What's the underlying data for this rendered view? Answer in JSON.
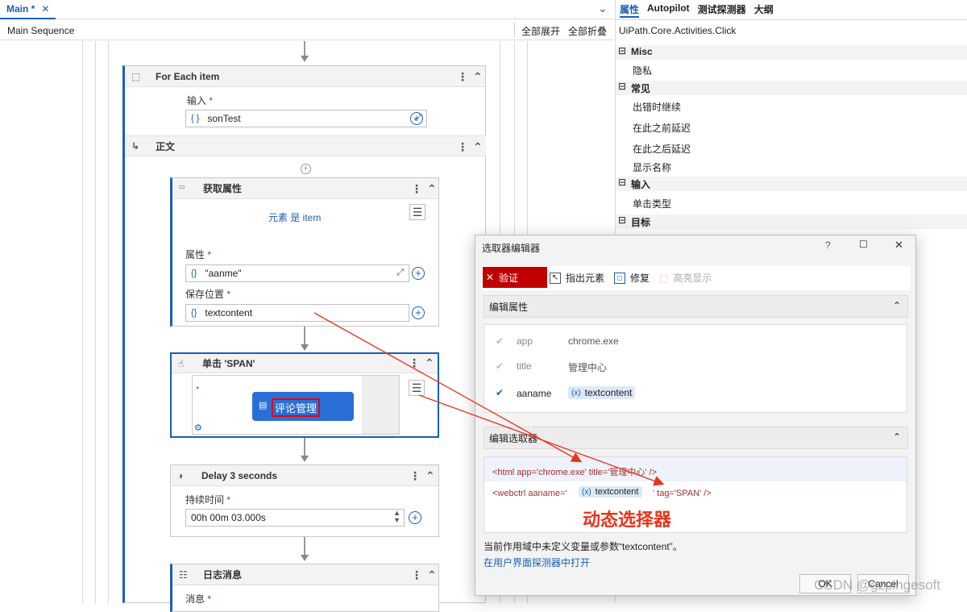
{
  "tabs": {
    "main_label": "Main *",
    "close_glyph": "✕",
    "dropdown_glyph": "⌄"
  },
  "subbar": {
    "breadcrumb": "Main Sequence",
    "expand_all": "全部展开",
    "collapse_all": "全部折叠"
  },
  "foreach": {
    "title": "For Each item",
    "input_label": "输入",
    "req": "*",
    "input_brace": "{ }",
    "input_value": "sonTest",
    "body_label": "正文"
  },
  "get_attr": {
    "title": "获取属性",
    "element_text": "元素 是 item",
    "attr_label": "属性",
    "attr_value": "\"aanme\"",
    "save_label": "保存位置",
    "save_value": "textcontent",
    "brace": "{}"
  },
  "click": {
    "title": "单击 'SPAN'",
    "preview_text": "评论管理"
  },
  "delay": {
    "title": "Delay 3 seconds",
    "duration_label": "持续时间",
    "duration_value": "00h 00m 03.000s"
  },
  "log": {
    "title": "日志消息",
    "message_label": "消息"
  },
  "props": {
    "tabs": [
      "属性",
      "Autopilot",
      "测试探测器",
      "大纲"
    ],
    "class_name": "UiPath.Core.Activities.Click",
    "rows": [
      {
        "text": "Misc",
        "section": true
      },
      {
        "text": "隐私",
        "section": false
      },
      {
        "text": "常见",
        "section": true
      },
      {
        "text": "出错时继续",
        "section": false
      },
      {
        "text": "在此之前延迟",
        "section": false
      },
      {
        "text": "在此之后延迟",
        "section": false
      },
      {
        "text": "显示名称",
        "section": false
      },
      {
        "text": "输入",
        "section": true
      },
      {
        "text": "单击类型",
        "section": false
      },
      {
        "text": "目标",
        "section": true
      }
    ]
  },
  "dialog": {
    "title": "选取器编辑器",
    "help": "?",
    "maximize": "☐",
    "close": "✕",
    "validate": "验证",
    "indicate": "指出元素",
    "repair": "修复",
    "highlight": "高亮显示",
    "edit_attrs": "编辑属性",
    "attrs": [
      {
        "name": "app",
        "value": "chrome.exe",
        "checked": true,
        "enabled": false
      },
      {
        "name": "title",
        "value": "管理中心",
        "checked": true,
        "enabled": false
      },
      {
        "name": "aaname",
        "value": "textcontent",
        "checked": true,
        "enabled": true,
        "chip": true
      }
    ],
    "edit_selector": "编辑选取器",
    "line1": "<html app='chrome.exe' title='管理中心' />",
    "line2_prefix": "<webctrl aaname='",
    "line2_var": "textcontent",
    "line2_suffix": "' tag='SPAN' />",
    "annotation": "动态选择器",
    "warning": "当前作用域中未定义变量或参数“textcontent”。",
    "open_link": "在用户界面探测器中打开",
    "ok": "OK",
    "cancel": "Cancel",
    "chip_icon": "(x)"
  },
  "watermark": "CSDN @gzpingesoft",
  "colors": {
    "accent": "#1a5fb4",
    "error_red": "#e8341c",
    "validate_red": "#c00000"
  }
}
